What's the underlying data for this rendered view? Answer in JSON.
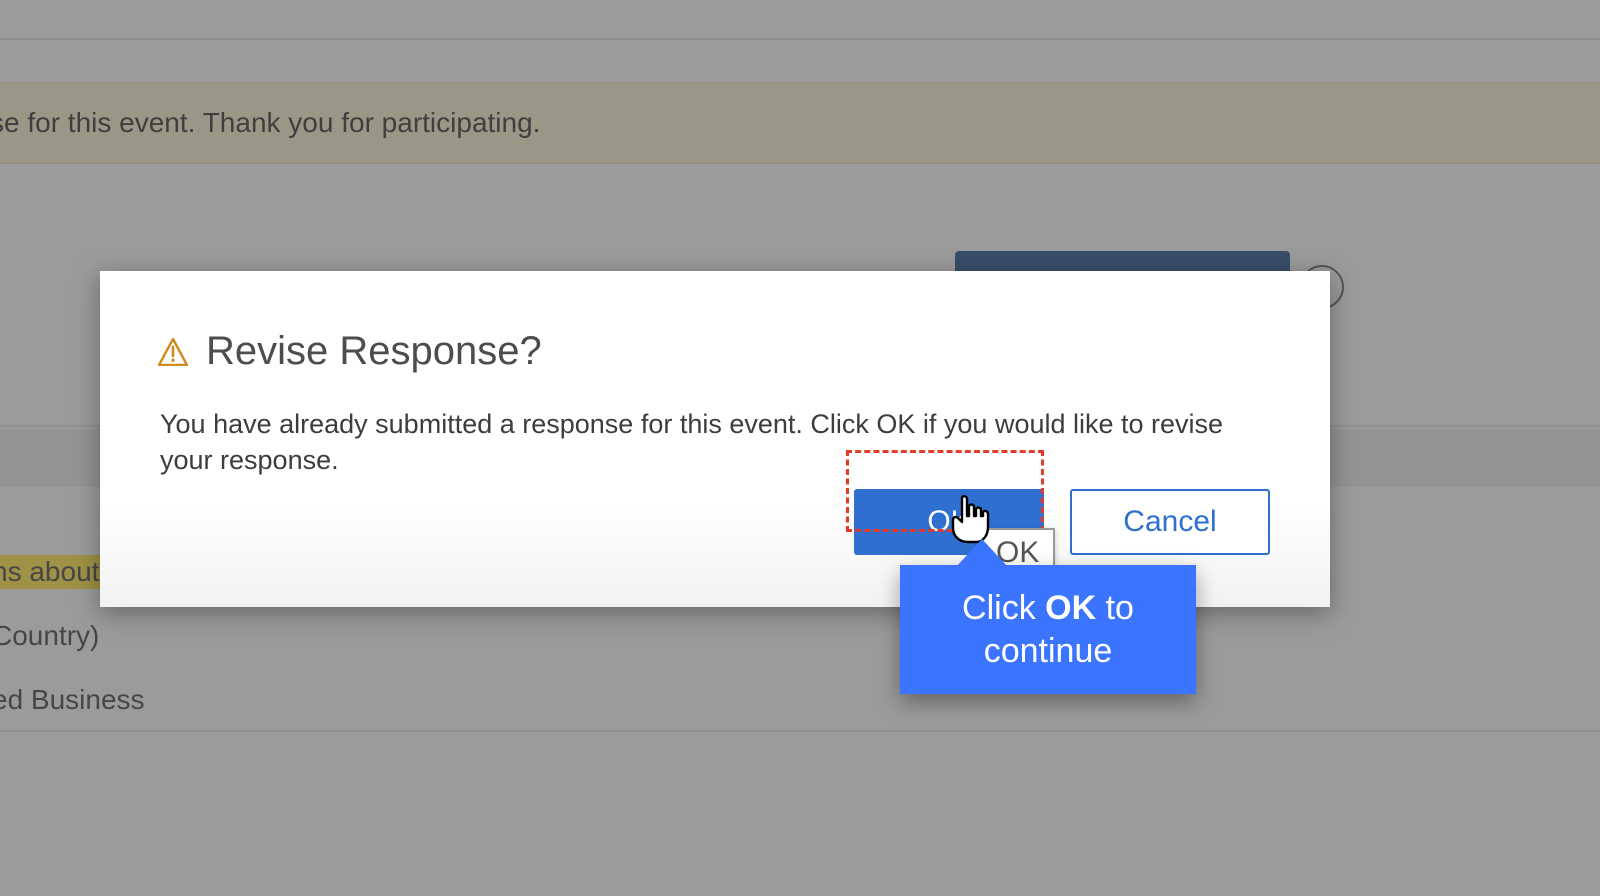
{
  "background": {
    "banner_text": "se for this event.  Thank you for participating.",
    "highlight_text": "ns about t",
    "line_country": "Country)",
    "line_business": "ed Business"
  },
  "modal": {
    "title": "Revise Response?",
    "body": "You have already submitted a response for this event. Click OK if you would like to revise your response.",
    "ok_label": "OK",
    "cancel_label": "Cancel"
  },
  "tooltip": {
    "text": "OK"
  },
  "callout": {
    "pre": "Click ",
    "bold": "OK",
    "post": " to continue"
  }
}
